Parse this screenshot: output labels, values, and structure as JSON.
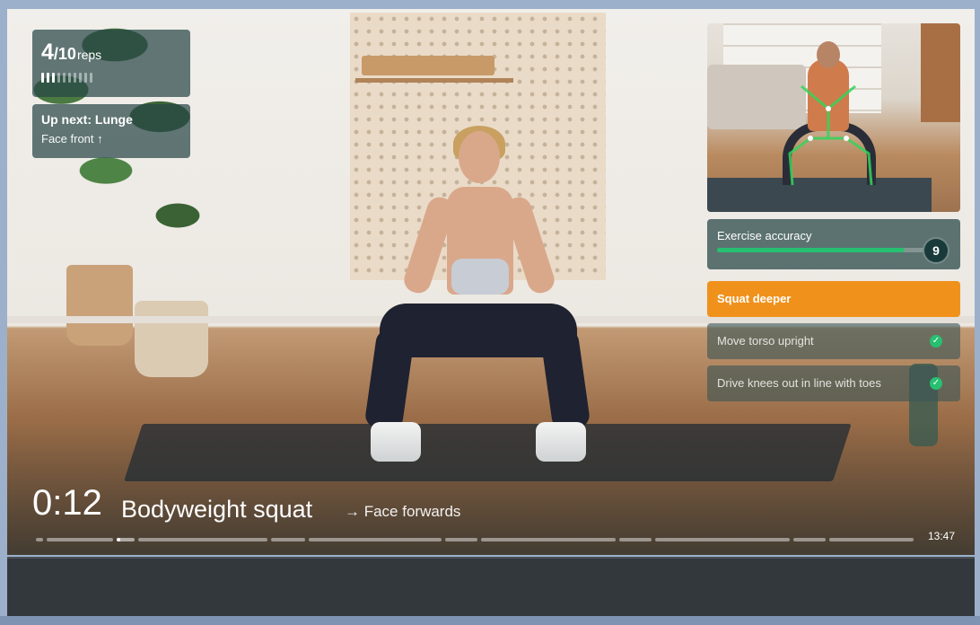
{
  "reps": {
    "current": "4",
    "total": "/10",
    "unit": "reps",
    "segments_total": 10,
    "segments_done": 3
  },
  "up_next": {
    "title": "Up next: Lunge",
    "subtitle": "Face front ↑"
  },
  "accuracy": {
    "label": "Exercise accuracy",
    "score": "9",
    "level": 0.9
  },
  "form_cues": [
    {
      "label": "Squat deeper",
      "state": "active"
    },
    {
      "label": "Move torso upright",
      "state": "done"
    },
    {
      "label": "Drive knees out in line with toes",
      "state": "done"
    }
  ],
  "player": {
    "elapsed": "0:12",
    "exercise": "Bodyweight squat",
    "next_cue": "→ Face forwards",
    "total_time": "13:47",
    "current_segment": 2,
    "segment_progress": 0.2
  },
  "icons": {
    "check": "check-icon",
    "arrow_up": "arrow-up-icon"
  },
  "colors": {
    "accent_orange": "#f0911c",
    "success_green": "#27c070",
    "panel_teal": "#2d4b4b"
  }
}
